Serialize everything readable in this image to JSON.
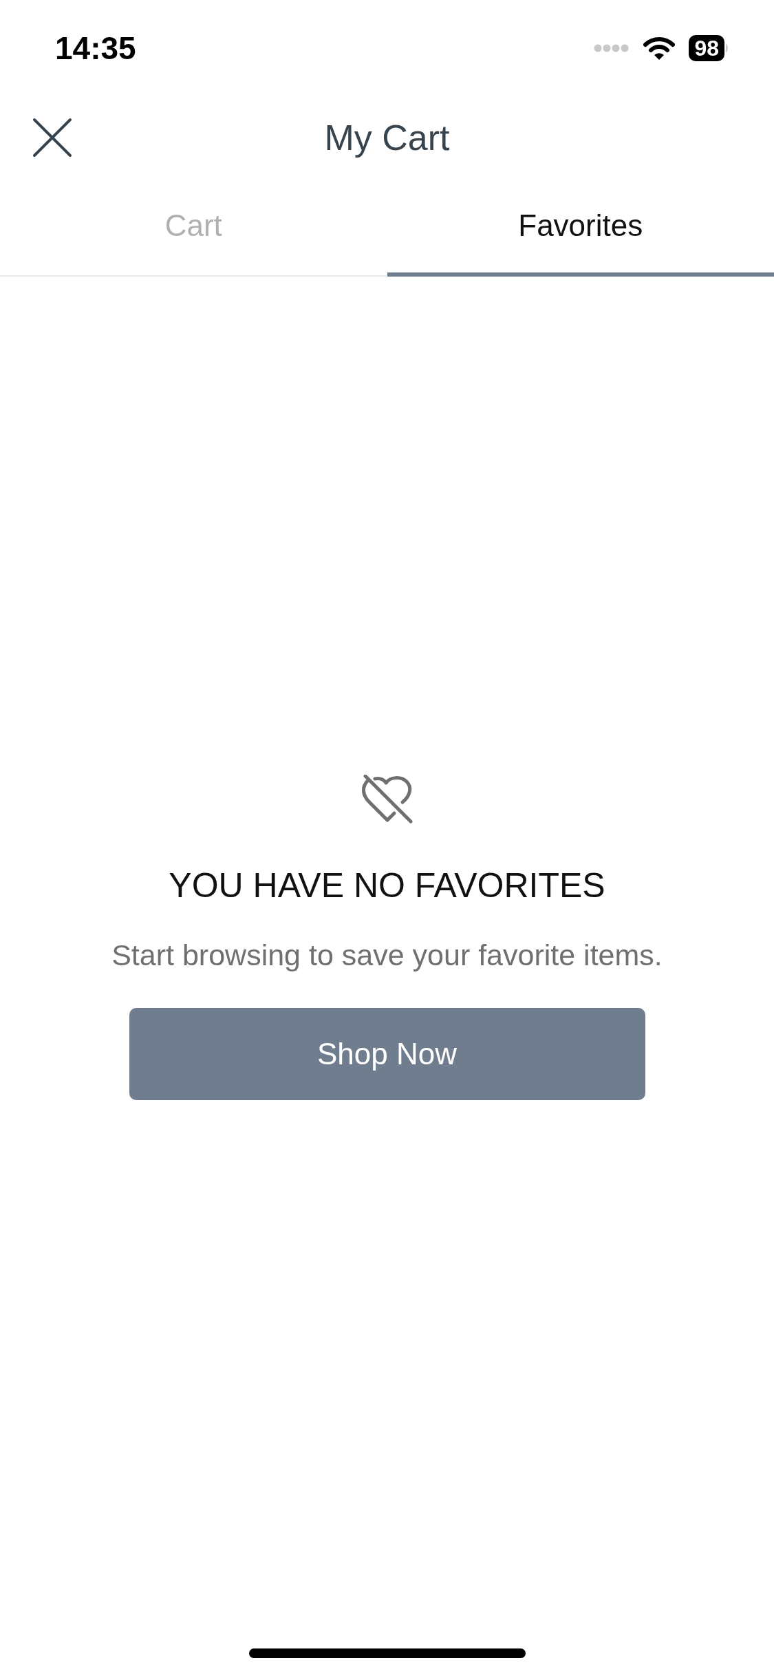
{
  "status_bar": {
    "time": "14:35",
    "battery": "98"
  },
  "header": {
    "title": "My Cart"
  },
  "tabs": [
    {
      "label": "Cart",
      "selected": false
    },
    {
      "label": "Favorites",
      "selected": true
    }
  ],
  "empty_state": {
    "heading": "YOU HAVE NO FAVORITES",
    "message": "Start browsing to save your favorite items.",
    "button": "Shop Now"
  }
}
